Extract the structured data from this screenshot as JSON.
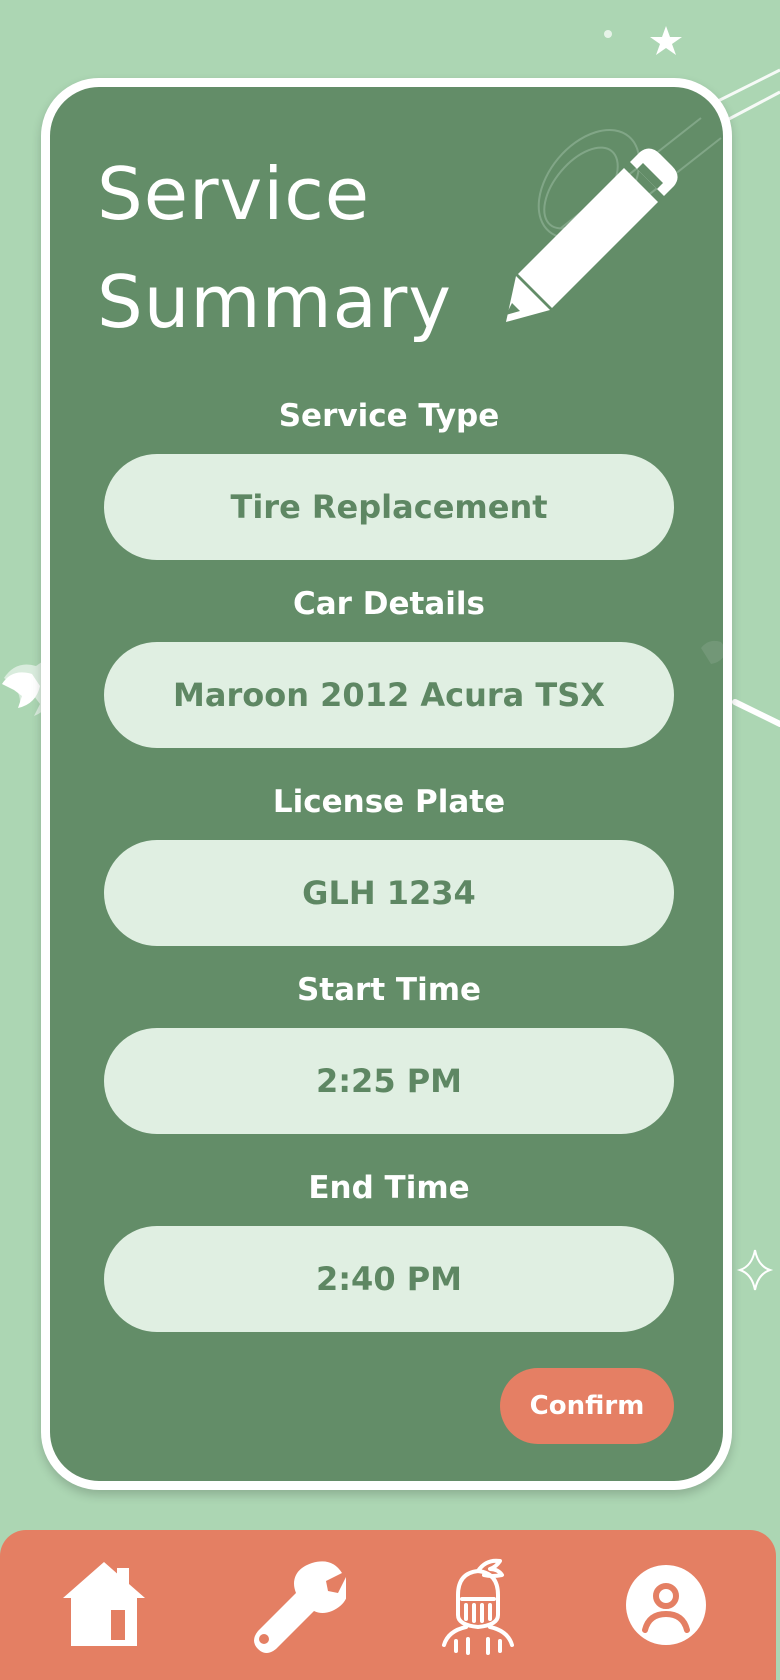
{
  "page": {
    "title": "Service Summary",
    "accent_color": "#e57f64",
    "card_color": "#638d68",
    "background_color": "#acd6b3",
    "edit_icon": "pencil-icon"
  },
  "form": {
    "fields": [
      {
        "label": "Service Type",
        "value": "Tire Replacement"
      },
      {
        "label": "Car Details",
        "value": "Maroon 2012 Acura TSX"
      },
      {
        "label": "License Plate",
        "value": "GLH 1234"
      },
      {
        "label": "Start Time",
        "value": "2:25 PM"
      },
      {
        "label": "End Time",
        "value": "2:40 PM"
      }
    ],
    "confirm_label": "Confirm"
  },
  "nav": {
    "items": [
      {
        "icon": "home-icon"
      },
      {
        "icon": "wrench-icon"
      },
      {
        "icon": "knight-helmet-icon"
      },
      {
        "icon": "profile-icon"
      }
    ]
  }
}
